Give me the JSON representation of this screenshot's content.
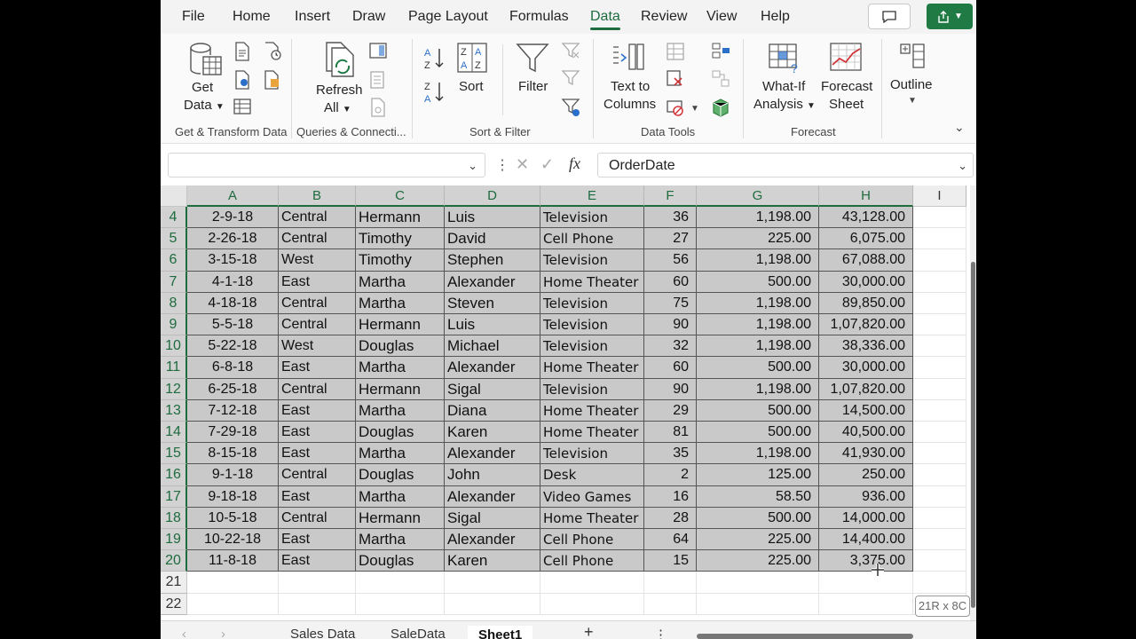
{
  "menu": {
    "items": [
      "File",
      "Home",
      "Insert",
      "Draw",
      "Page Layout",
      "Formulas",
      "Data",
      "Review",
      "View",
      "Help"
    ],
    "active": "Data"
  },
  "ribbon": {
    "get_data_line1": "Get",
    "get_data_line2": "Data",
    "refresh_line1": "Refresh",
    "refresh_line2": "All",
    "sort": "Sort",
    "filter": "Filter",
    "text_to_columns_line1": "Text to",
    "text_to_columns_line2": "Columns",
    "what_if_line1": "What-If",
    "what_if_line2": "Analysis",
    "forecast_line1": "Forecast",
    "forecast_line2": "Sheet",
    "outline": "Outline",
    "groups": {
      "get_transform": "Get & Transform Data",
      "queries": "Queries & Connecti...",
      "sort_filter": "Sort & Filter",
      "data_tools": "Data Tools",
      "forecast": "Forecast"
    }
  },
  "formula_bar": {
    "name_box": "",
    "fx": "fx",
    "value": "OrderDate"
  },
  "columns": [
    "A",
    "B",
    "C",
    "D",
    "E",
    "F",
    "G",
    "H",
    "I"
  ],
  "rows": [
    {
      "n": "4",
      "a": "2-9-18",
      "b": "Central",
      "c": "Hermann",
      "d": "Luis",
      "e": "Television",
      "f": "36",
      "g": "1,198.00",
      "h": "43,128.00"
    },
    {
      "n": "5",
      "a": "2-26-18",
      "b": "Central",
      "c": "Timothy",
      "d": "David",
      "e": "Cell Phone",
      "f": "27",
      "g": "225.00",
      "h": "6,075.00"
    },
    {
      "n": "6",
      "a": "3-15-18",
      "b": "West",
      "c": "Timothy",
      "d": "Stephen",
      "e": "Television",
      "f": "56",
      "g": "1,198.00",
      "h": "67,088.00"
    },
    {
      "n": "7",
      "a": "4-1-18",
      "b": "East",
      "c": "Martha",
      "d": "Alexander",
      "e": "Home Theater",
      "f": "60",
      "g": "500.00",
      "h": "30,000.00"
    },
    {
      "n": "8",
      "a": "4-18-18",
      "b": "Central",
      "c": "Martha",
      "d": "Steven",
      "e": "Television",
      "f": "75",
      "g": "1,198.00",
      "h": "89,850.00"
    },
    {
      "n": "9",
      "a": "5-5-18",
      "b": "Central",
      "c": "Hermann",
      "d": "Luis",
      "e": "Television",
      "f": "90",
      "g": "1,198.00",
      "h": "1,07,820.00"
    },
    {
      "n": "10",
      "a": "5-22-18",
      "b": "West",
      "c": "Douglas",
      "d": "Michael",
      "e": "Television",
      "f": "32",
      "g": "1,198.00",
      "h": "38,336.00"
    },
    {
      "n": "11",
      "a": "6-8-18",
      "b": "East",
      "c": "Martha",
      "d": "Alexander",
      "e": "Home Theater",
      "f": "60",
      "g": "500.00",
      "h": "30,000.00"
    },
    {
      "n": "12",
      "a": "6-25-18",
      "b": "Central",
      "c": "Hermann",
      "d": "Sigal",
      "e": "Television",
      "f": "90",
      "g": "1,198.00",
      "h": "1,07,820.00"
    },
    {
      "n": "13",
      "a": "7-12-18",
      "b": "East",
      "c": "Martha",
      "d": "Diana",
      "e": "Home Theater",
      "f": "29",
      "g": "500.00",
      "h": "14,500.00"
    },
    {
      "n": "14",
      "a": "7-29-18",
      "b": "East",
      "c": "Douglas",
      "d": "Karen",
      "e": "Home Theater",
      "f": "81",
      "g": "500.00",
      "h": "40,500.00"
    },
    {
      "n": "15",
      "a": "8-15-18",
      "b": "East",
      "c": "Martha",
      "d": "Alexander",
      "e": "Television",
      "f": "35",
      "g": "1,198.00",
      "h": "41,930.00"
    },
    {
      "n": "16",
      "a": "9-1-18",
      "b": "Central",
      "c": "Douglas",
      "d": "John",
      "e": "Desk",
      "f": "2",
      "g": "125.00",
      "h": "250.00"
    },
    {
      "n": "17",
      "a": "9-18-18",
      "b": "East",
      "c": "Martha",
      "d": "Alexander",
      "e": "Video Games",
      "f": "16",
      "g": "58.50",
      "h": "936.00"
    },
    {
      "n": "18",
      "a": "10-5-18",
      "b": "Central",
      "c": "Hermann",
      "d": "Sigal",
      "e": "Home Theater",
      "f": "28",
      "g": "500.00",
      "h": "14,000.00"
    },
    {
      "n": "19",
      "a": "10-22-18",
      "b": "East",
      "c": "Martha",
      "d": "Alexander",
      "e": "Cell Phone",
      "f": "64",
      "g": "225.00",
      "h": "14,400.00"
    },
    {
      "n": "20",
      "a": "11-8-18",
      "b": "East",
      "c": "Douglas",
      "d": "Karen",
      "e": "Cell Phone",
      "f": "15",
      "g": "225.00",
      "h": "3,375.00"
    }
  ],
  "empty_rows": [
    "21",
    "22"
  ],
  "quick_analysis_tag": "21R x 8C",
  "sheet_tabs": [
    "Sales Data",
    "SaleData",
    "Sheet1"
  ],
  "active_sheet": "Sheet1",
  "add_sheet": "+",
  "more": "⋮"
}
